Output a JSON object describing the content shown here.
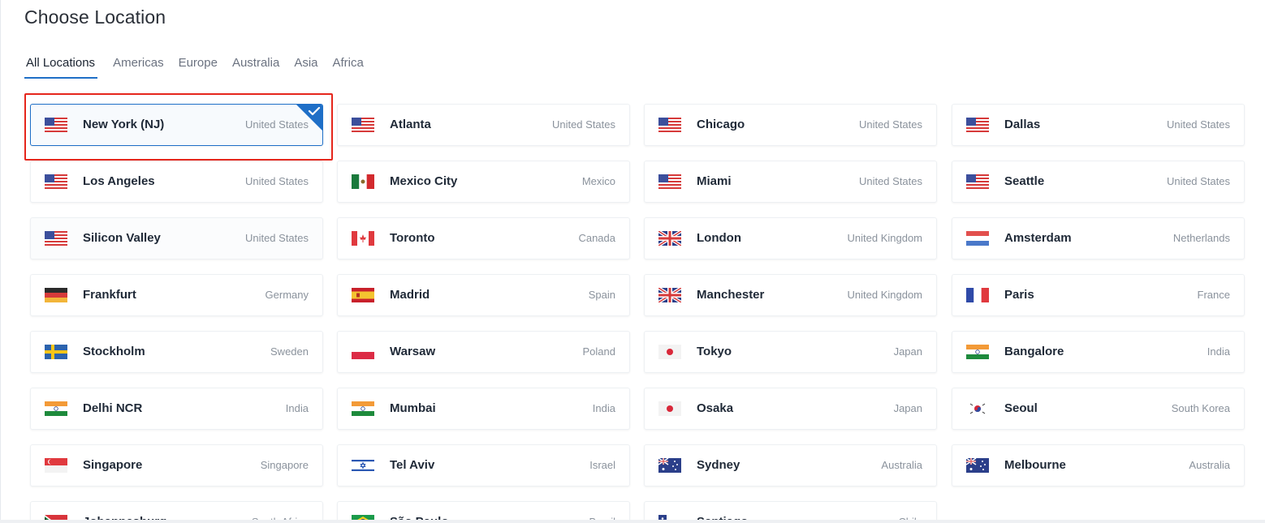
{
  "page": {
    "title": "Choose Location"
  },
  "tabs": [
    "All Locations",
    "Americas",
    "Europe",
    "Australia",
    "Asia",
    "Africa"
  ],
  "active_tab": "All Locations",
  "colors": {
    "accent": "#1f6fc7",
    "highlight_outline": "#e5261c"
  },
  "locations": [
    {
      "city": "New York (NJ)",
      "country": "United States",
      "flag": "us-flag-icon",
      "selected": true
    },
    {
      "city": "Atlanta",
      "country": "United States",
      "flag": "us-flag-icon"
    },
    {
      "city": "Chicago",
      "country": "United States",
      "flag": "us-flag-icon"
    },
    {
      "city": "Dallas",
      "country": "United States",
      "flag": "us-flag-icon"
    },
    {
      "city": "Los Angeles",
      "country": "United States",
      "flag": "us-flag-icon"
    },
    {
      "city": "Mexico City",
      "country": "Mexico",
      "flag": "mx-flag-icon"
    },
    {
      "city": "Miami",
      "country": "United States",
      "flag": "us-flag-icon"
    },
    {
      "city": "Seattle",
      "country": "United States",
      "flag": "us-flag-icon"
    },
    {
      "city": "Silicon Valley",
      "country": "United States",
      "flag": "us-flag-icon"
    },
    {
      "city": "Toronto",
      "country": "Canada",
      "flag": "ca-flag-icon"
    },
    {
      "city": "London",
      "country": "United Kingdom",
      "flag": "gb-flag-icon"
    },
    {
      "city": "Amsterdam",
      "country": "Netherlands",
      "flag": "nl-flag-icon"
    },
    {
      "city": "Frankfurt",
      "country": "Germany",
      "flag": "de-flag-icon"
    },
    {
      "city": "Madrid",
      "country": "Spain",
      "flag": "es-flag-icon"
    },
    {
      "city": "Manchester",
      "country": "United Kingdom",
      "flag": "gb-flag-icon"
    },
    {
      "city": "Paris",
      "country": "France",
      "flag": "fr-flag-icon"
    },
    {
      "city": "Stockholm",
      "country": "Sweden",
      "flag": "se-flag-icon"
    },
    {
      "city": "Warsaw",
      "country": "Poland",
      "flag": "pl-flag-icon"
    },
    {
      "city": "Tokyo",
      "country": "Japan",
      "flag": "jp-flag-icon"
    },
    {
      "city": "Bangalore",
      "country": "India",
      "flag": "in-flag-icon"
    },
    {
      "city": "Delhi NCR",
      "country": "India",
      "flag": "in-flag-icon"
    },
    {
      "city": "Mumbai",
      "country": "India",
      "flag": "in-flag-icon"
    },
    {
      "city": "Osaka",
      "country": "Japan",
      "flag": "jp-flag-icon"
    },
    {
      "city": "Seoul",
      "country": "South Korea",
      "flag": "kr-flag-icon"
    },
    {
      "city": "Singapore",
      "country": "Singapore",
      "flag": "sg-flag-icon"
    },
    {
      "city": "Tel Aviv",
      "country": "Israel",
      "flag": "il-flag-icon"
    },
    {
      "city": "Sydney",
      "country": "Australia",
      "flag": "au-flag-icon"
    },
    {
      "city": "Melbourne",
      "country": "Australia",
      "flag": "au-flag-icon"
    },
    {
      "city": "Johannesburg",
      "country": "South Africa",
      "flag": "za-flag-icon"
    },
    {
      "city": "São Paulo",
      "country": "Brazil",
      "flag": "br-flag-icon"
    },
    {
      "city": "Santiago",
      "country": "Chile",
      "flag": "cl-flag-icon"
    }
  ]
}
